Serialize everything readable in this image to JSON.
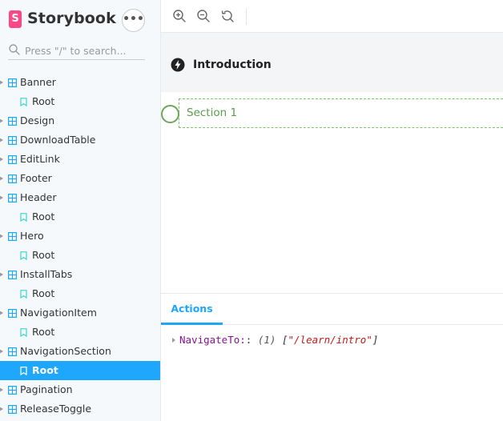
{
  "app": {
    "brand": "Storybook",
    "logo_letter": "S",
    "accent": "#1ea7fd",
    "brand_pink": "#ff4785"
  },
  "search": {
    "placeholder": "Press \"/\" to search..."
  },
  "tree": [
    {
      "label": "Banner",
      "type": "component"
    },
    {
      "label": "Root",
      "type": "story"
    },
    {
      "label": "Design",
      "type": "component"
    },
    {
      "label": "DownloadTable",
      "type": "component"
    },
    {
      "label": "EditLink",
      "type": "component"
    },
    {
      "label": "Footer",
      "type": "component"
    },
    {
      "label": "Header",
      "type": "component"
    },
    {
      "label": "Root",
      "type": "story"
    },
    {
      "label": "Hero",
      "type": "component"
    },
    {
      "label": "Root",
      "type": "story"
    },
    {
      "label": "InstallTabs",
      "type": "component"
    },
    {
      "label": "Root",
      "type": "story"
    },
    {
      "label": "NavigationItem",
      "type": "component"
    },
    {
      "label": "Root",
      "type": "story"
    },
    {
      "label": "NavigationSection",
      "type": "component"
    },
    {
      "label": "Root",
      "type": "story",
      "selected": true
    },
    {
      "label": "Pagination",
      "type": "component"
    },
    {
      "label": "ReleaseToggle",
      "type": "component"
    }
  ],
  "toolbar": {
    "icons": [
      "zoom-in-icon",
      "zoom-out-icon",
      "zoom-reset-icon"
    ]
  },
  "preview": {
    "intro_title": "Introduction",
    "section_label": "Section 1"
  },
  "panel": {
    "active_tab": "Actions",
    "log": {
      "name": "NavigateTo:",
      "sep": ":",
      "count": "(1)",
      "open": "[",
      "value": "\"/learn/intro\"",
      "close": "]"
    }
  }
}
